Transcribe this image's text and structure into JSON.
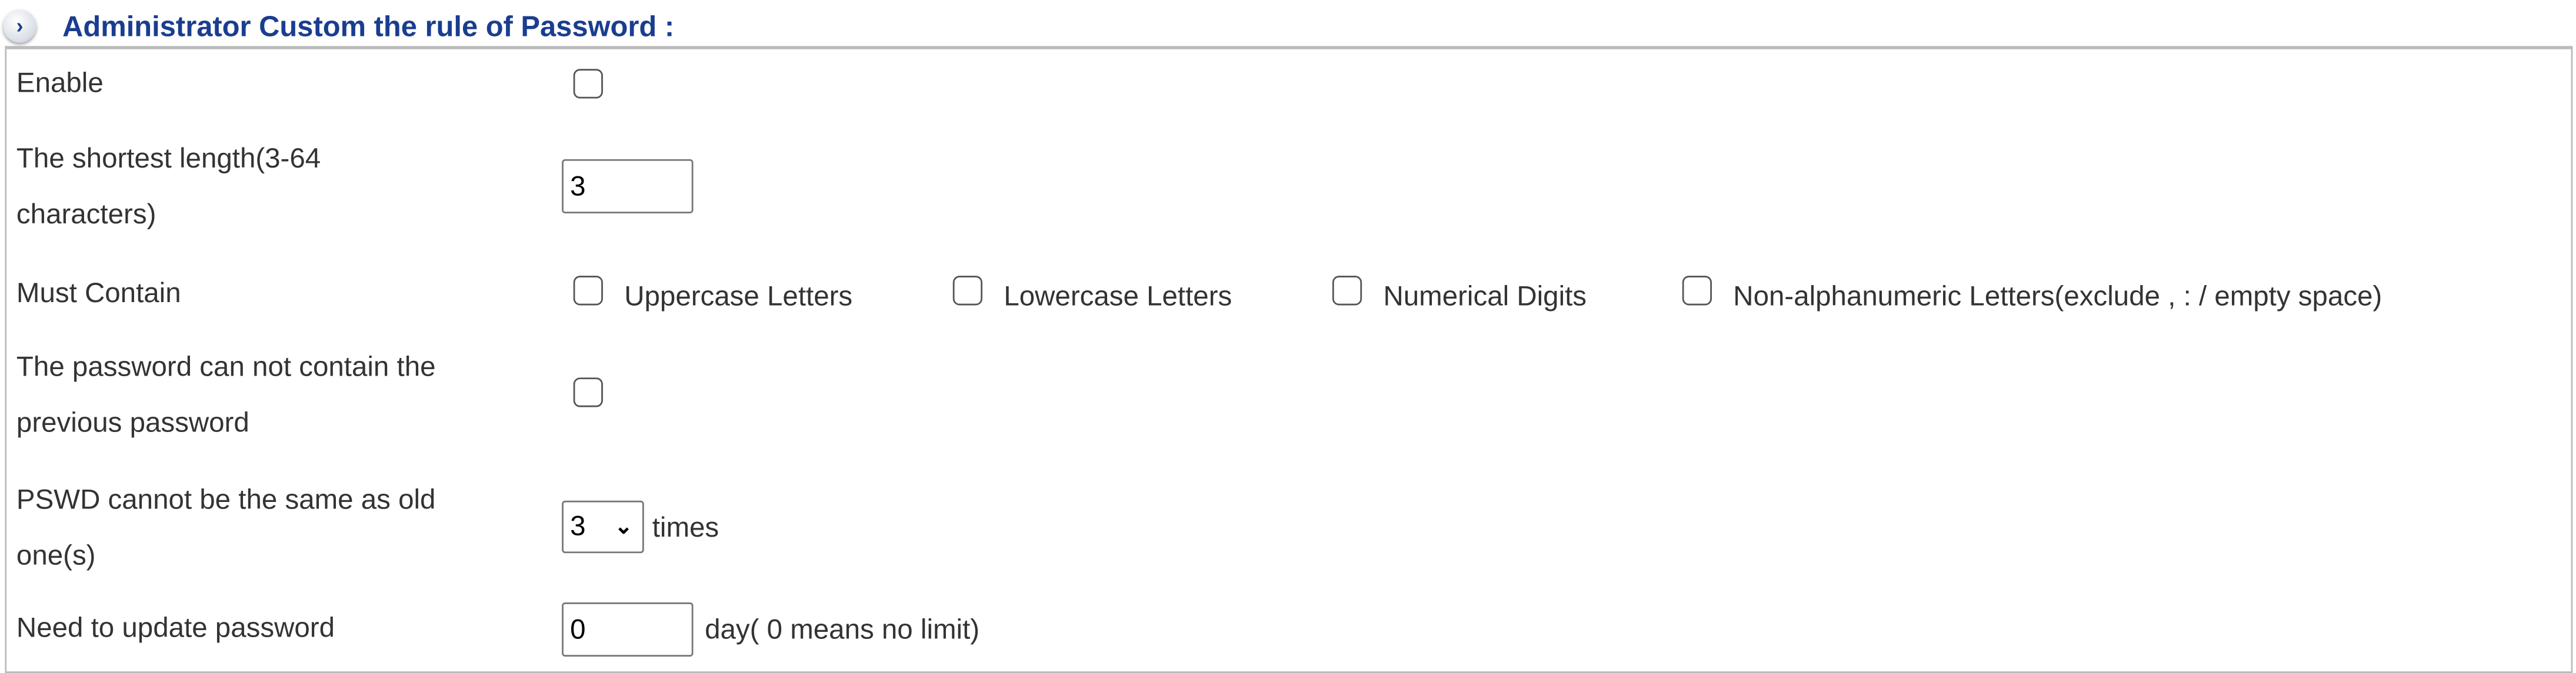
{
  "header": {
    "icon": "chevron-right-circle-icon",
    "title": "Administrator Custom the rule of Password :"
  },
  "rows": {
    "enable": {
      "label": "Enable",
      "checked": false
    },
    "min_length": {
      "label_line1": "The shortest length(3-64",
      "label_line2": "characters)",
      "value": "3"
    },
    "must_contain": {
      "label": "Must Contain",
      "options": [
        {
          "label": "Uppercase Letters",
          "checked": false
        },
        {
          "label": "Lowercase Letters",
          "checked": false
        },
        {
          "label": "Numerical Digits",
          "checked": false
        },
        {
          "label": "Non-alphanumeric Letters(exclude , : / empty space)",
          "checked": false
        }
      ]
    },
    "no_previous": {
      "label_line1": "The password can not contain the",
      "label_line2": "previous password",
      "checked": false
    },
    "history": {
      "label_line1": "PSWD cannot be the same as old",
      "label_line2": "one(s)",
      "value": "3",
      "suffix": "times"
    },
    "expiry": {
      "label": "Need to update password",
      "value": "0",
      "suffix": "day( 0 means no limit)"
    }
  },
  "colors": {
    "header": "#1a3d8f",
    "text": "#333333",
    "border": "#bbbbbb"
  }
}
